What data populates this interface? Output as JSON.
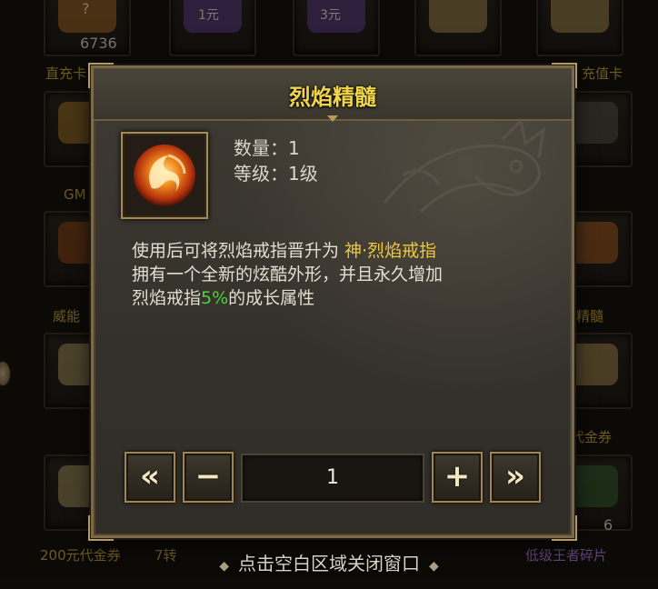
{
  "background": {
    "labels": [
      {
        "key": "top_left",
        "text": "直充卡"
      },
      {
        "key": "top_right",
        "text": "充值卡"
      },
      {
        "key": "row2_left",
        "text": "GM"
      },
      {
        "key": "row3_left",
        "text": "威能"
      },
      {
        "key": "row3_right",
        "text": "精髓"
      },
      {
        "key": "row4_right",
        "text": "代金券"
      },
      {
        "key": "row5_left",
        "text": "200元代金券"
      },
      {
        "key": "row5_mid",
        "text": "7转"
      },
      {
        "key": "row5_right",
        "text": "低级王者碎片"
      }
    ],
    "top_cells": [
      "?",
      "1元",
      "3元"
    ],
    "counts": {
      "top_left": "6736",
      "right_bottom": "6"
    }
  },
  "dialog": {
    "title": "烈焰精髓",
    "item_icon": "phoenix-flame-icon",
    "quantity_label": "数量：1",
    "level_label": "等级：1级",
    "description": {
      "line1_prefix": "使用后可将烈焰戒指晋升为 ",
      "line1_highlight": "神·烈焰戒指",
      "line2": "拥有一个全新的炫酷外形，并且永久增加",
      "line3_prefix": "烈焰戒指",
      "line3_highlight": "5%",
      "line3_suffix": "的成长属性"
    },
    "controls": {
      "min_label": "«",
      "minus_label": "−",
      "quantity_value": "1",
      "plus_label": "+",
      "max_label": "»"
    }
  },
  "footer": {
    "hint": "点击空白区域关闭窗口"
  },
  "colors": {
    "title_gold": "#f2d64a",
    "highlight_gold": "#f0c93a",
    "highlight_green": "#4fd23a",
    "frame_border": "#7b6a49"
  }
}
